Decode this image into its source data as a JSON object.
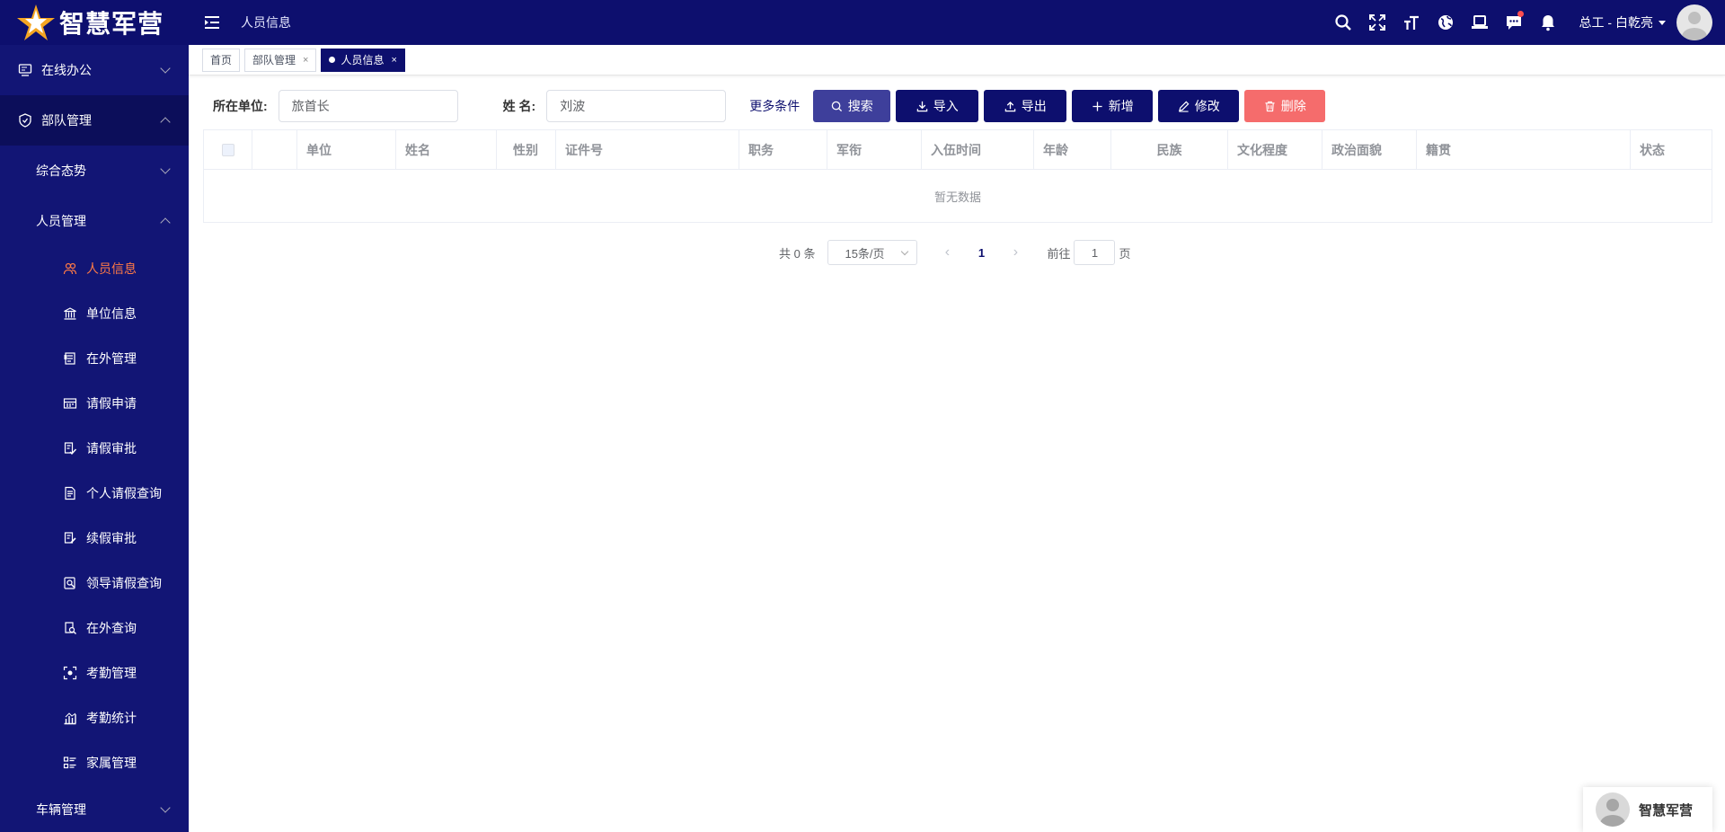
{
  "app": {
    "logo_text": "智慧军营"
  },
  "topbar": {
    "breadcrumb": "人员信息",
    "tools": [
      "search-icon",
      "fullscreen-icon",
      "font-size-icon",
      "globe-icon",
      "laptop-icon",
      "message-icon",
      "bell-icon"
    ],
    "user_name": "总工 - 白乾亮"
  },
  "sidebar": {
    "groups": [
      {
        "label": "在线办公",
        "icon": "monitor-icon",
        "expanded": false
      },
      {
        "label": "部队管理",
        "icon": "shield-icon",
        "expanded": true
      }
    ],
    "subgroups": [
      {
        "label": "综合态势",
        "expanded": false
      },
      {
        "label": "人员管理",
        "expanded": true
      }
    ],
    "items": [
      {
        "label": "人员信息",
        "icon": "people-icon",
        "active": true
      },
      {
        "label": "单位信息",
        "icon": "bank-icon"
      },
      {
        "label": "在外管理",
        "icon": "document-icon"
      },
      {
        "label": "请假申请",
        "icon": "calendar-icon"
      },
      {
        "label": "请假审批",
        "icon": "approve-icon"
      },
      {
        "label": "个人请假查询",
        "icon": "file-list-icon"
      },
      {
        "label": "续假审批",
        "icon": "edit-check-icon"
      },
      {
        "label": "领导请假查询",
        "icon": "search-file-icon"
      },
      {
        "label": "在外查询",
        "icon": "search-doc-icon"
      },
      {
        "label": "考勤管理",
        "icon": "scan-icon"
      },
      {
        "label": "考勤统计",
        "icon": "bar-chart-icon"
      },
      {
        "label": "家属管理",
        "icon": "list-icon"
      }
    ],
    "bottom_group": {
      "label": "车辆管理",
      "expanded": false
    }
  },
  "tags": [
    {
      "label": "首页",
      "closable": false,
      "active": false
    },
    {
      "label": "部队管理",
      "closable": true,
      "active": false
    },
    {
      "label": "人员信息",
      "closable": true,
      "active": true
    }
  ],
  "tag_close": "×",
  "form": {
    "unit_label": "所在单位:",
    "unit_value": "旅首长",
    "name_label": "姓 名:",
    "name_value": "刘波",
    "more_label": "更多条件",
    "buttons": {
      "search": "搜索",
      "import": "导入",
      "export": "导出",
      "add": "新增",
      "edit": "修改",
      "delete": "删除"
    }
  },
  "table": {
    "columns": [
      "单位",
      "姓名",
      "性别",
      "证件号",
      "职务",
      "军衔",
      "入伍时间",
      "年龄",
      "民族",
      "文化程度",
      "政治面貌",
      "籍贯",
      "状态"
    ],
    "empty_text": "暂无数据"
  },
  "pagination": {
    "total_text": "共 0 条",
    "page_size": "15条/页",
    "current_page": "1",
    "goto_prefix": "前往",
    "goto_value": "1",
    "goto_suffix": "页"
  },
  "float_widget": {
    "label": "智慧军营"
  },
  "colors": {
    "primary": "#0d0f6e",
    "sidebar": "#121575",
    "active_menu": "#ff7a45",
    "danger": "#f56c6c",
    "search_btn": "#3e3f9b"
  }
}
